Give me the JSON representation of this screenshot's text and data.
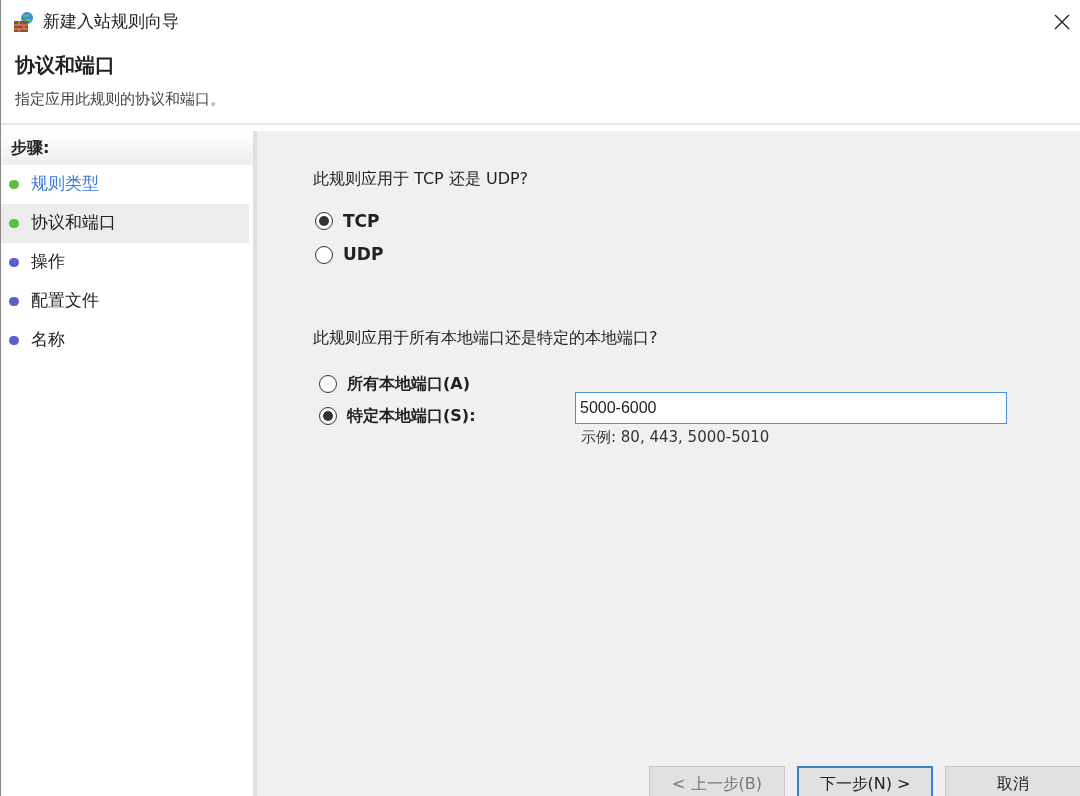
{
  "window": {
    "title": "新建入站规则向导"
  },
  "header": {
    "title": "协议和端口",
    "subtitle": "指定应用此规则的协议和端口。"
  },
  "steps": {
    "heading": "步骤:",
    "items": [
      {
        "label": "规则类型",
        "color": "#5cbf3c",
        "selected": false,
        "link": true
      },
      {
        "label": "协议和端口",
        "color": "#5cbf3c",
        "selected": true,
        "link": false
      },
      {
        "label": "操作",
        "color": "#5a5fd0",
        "selected": false,
        "link": false
      },
      {
        "label": "配置文件",
        "color": "#5a5fd0",
        "selected": false,
        "link": false
      },
      {
        "label": "名称",
        "color": "#5a5fd0",
        "selected": false,
        "link": false
      }
    ]
  },
  "protocol": {
    "question": "此规则应用于 TCP 还是 UDP?",
    "options": [
      {
        "label": "TCP",
        "selected": true
      },
      {
        "label": "UDP",
        "selected": false
      }
    ]
  },
  "ports": {
    "question": "此规则应用于所有本地端口还是特定的本地端口?",
    "options": [
      {
        "label": "所有本地端口(A)",
        "selected": false
      },
      {
        "label": "特定本地端口(S):",
        "selected": true
      }
    ],
    "field": {
      "value": "5000-6000"
    },
    "example": "示例: 80, 443, 5000-5010"
  },
  "buttons": [
    {
      "label": "< 上一步(B)",
      "disabled": true,
      "default": false
    },
    {
      "label": "下一步(N) >",
      "disabled": false,
      "default": true
    },
    {
      "label": "取消",
      "disabled": false,
      "default": false
    }
  ]
}
